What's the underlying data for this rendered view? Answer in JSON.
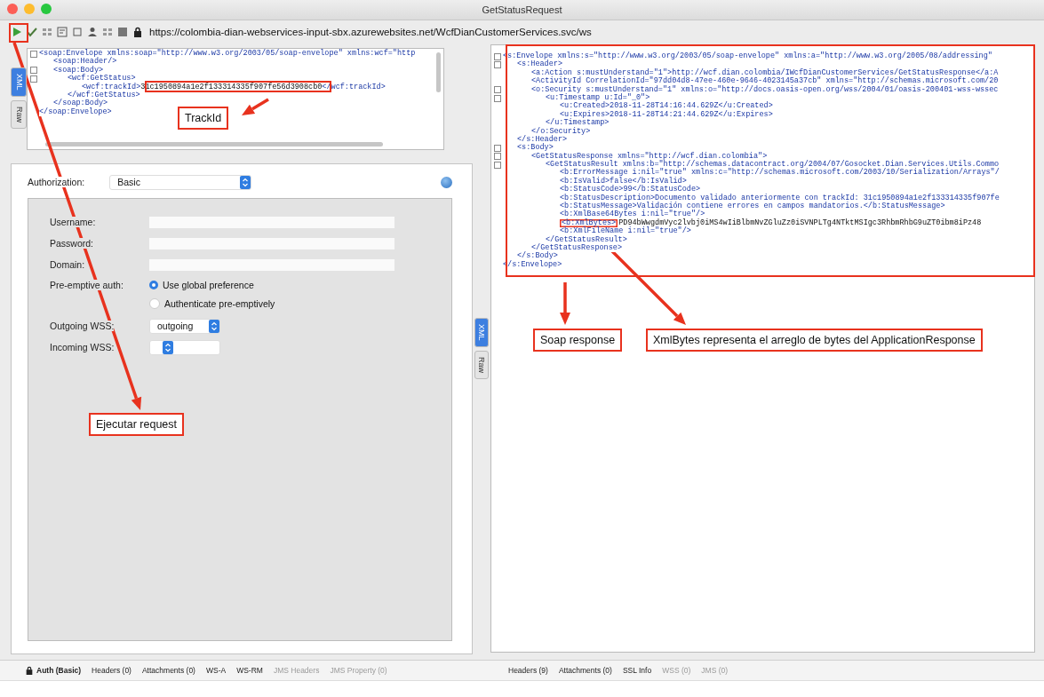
{
  "window": {
    "title": "GetStatusRequest"
  },
  "toolbar": {
    "url": "https://colombia-dian-webservices-input-sbx.azurewebsites.net/WcfDianCustomerServices.svc/ws"
  },
  "request_editor": {
    "tabs": [
      {
        "label": "XML",
        "selected": true
      },
      {
        "label": "Raw",
        "selected": false
      }
    ],
    "xml": [
      {
        "open": "<soap:Envelope xmlns:soap=\"http://www.w3.org/2003/05/soap-envelope\" xmlns:wcf=\"http",
        "close": "</soap:Envelope>",
        "children": [
          {
            "text": "<soap:Header/>"
          },
          {
            "open": "<soap:Body>",
            "close": "</soap:Body>",
            "children": [
              {
                "open": "<wcf:GetStatus>",
                "close": "</wcf:GetStatus>",
                "children": [
                  {
                    "tag": "<wcf:trackId>",
                    "value": "31c1950894a1e2f133314335f907fe56d3908cb0",
                    "end": "</wcf:trackId>"
                  }
                ]
              }
            ]
          }
        ]
      }
    ]
  },
  "auth": {
    "authorization": {
      "label": "Authorization:",
      "value": "Basic"
    },
    "fields": [
      {
        "label": "Username:"
      },
      {
        "label": "Password:"
      },
      {
        "label": "Domain:"
      }
    ],
    "preemptive": {
      "label": "Pre-emptive auth:",
      "options": [
        {
          "label": "Use global preference",
          "selected": true
        },
        {
          "label": "Authenticate pre-emptively",
          "selected": false
        }
      ]
    },
    "wss": [
      {
        "label": "Outgoing WSS:",
        "value": "outgoing"
      },
      {
        "label": "Incoming WSS:"
      }
    ]
  },
  "request_tabs": [
    {
      "label": "Auth (Basic)",
      "selected": true,
      "disabled": false
    },
    {
      "label": "Headers (0)",
      "selected": false,
      "disabled": false
    },
    {
      "label": "Attachments (0)",
      "selected": false,
      "disabled": false
    },
    {
      "label": "WS-A",
      "selected": false,
      "disabled": false
    },
    {
      "label": "WS-RM",
      "selected": false,
      "disabled": false
    },
    {
      "label": "JMS Headers",
      "selected": false,
      "disabled": true
    },
    {
      "label": "JMS Property (0)",
      "selected": false,
      "disabled": true
    }
  ],
  "response_editor": {
    "tabs": [
      {
        "label": "XML",
        "selected": true
      },
      {
        "label": "Raw",
        "selected": false
      }
    ],
    "xml": [
      {
        "open": "<s:Envelope xmlns:s=\"http://www.w3.org/2003/05/soap-envelope\" xmlns:a=\"http://www.w3.org/2005/08/addressing\"",
        "close": "</s:Envelope>",
        "children": [
          {
            "open": "<s:Header>",
            "close": "</s:Header>",
            "children": [
              {
                "text": "<a:Action s:mustUnderstand=\"1\">http://wcf.dian.colombia/IWcfDianCustomerServices/GetStatusResponse</a:A"
              },
              {
                "text": "<ActivityId CorrelationId=\"97dd04d8-47ee-460e-9646-4023145a37cb\" xmlns=\"http://schemas.microsoft.com/20"
              },
              {
                "open": "<o:Security s:mustUnderstand=\"1\" xmlns:o=\"http://docs.oasis-open.org/wss/2004/01/oasis-200401-wss-wssec",
                "close": "</o:Security>",
                "children": [
                  {
                    "open": "<u:Timestamp u:Id=\"_0\">",
                    "close": "</u:Timestamp>",
                    "children": [
                      {
                        "text": "<u:Created>2018-11-28T14:16:44.629Z</u:Created>"
                      },
                      {
                        "text": "<u:Expires>2018-11-28T14:21:44.629Z</u:Expires>"
                      }
                    ]
                  }
                ]
              }
            ]
          },
          {
            "open": "<s:Body>",
            "close": "</s:Body>",
            "children": [
              {
                "open": "<GetStatusResponse xmlns=\"http://wcf.dian.colombia\">",
                "close": "</GetStatusResponse>",
                "children": [
                  {
                    "open": "<GetStatusResult xmlns:b=\"http://schemas.datacontract.org/2004/07/Gosocket.Dian.Services.Utils.Commo",
                    "close": "</GetStatusResult>",
                    "children": [
                      {
                        "text": "<b:ErrorMessage i:nil=\"true\" xmlns:c=\"http://schemas.microsoft.com/2003/10/Serialization/Arrays\"/"
                      },
                      {
                        "text": "<b:IsValid>false</b:IsValid>"
                      },
                      {
                        "text": "<b:StatusCode>99</b:StatusCode>"
                      },
                      {
                        "text": "<b:StatusDescription>Documento validado anteriormente con trackId: 31c1950894a1e2f133314335f907fe"
                      },
                      {
                        "text": "<b:StatusMessage>Validación contiene errores en campos mandatorios.</b:StatusMessage>"
                      },
                      {
                        "text": "<b:XmlBase64Bytes i:nil=\"true\"/>"
                      },
                      {
                        "tag": "<b:XmlBytes>",
                        "value": "PD94bWwgdmVyc2lvbj0iMS4wIiBlbmNvZGluZz0iSVNPLTg4NTktMSIgc3RhbmRhbG9uZT0ibm8iPz48"
                      },
                      {
                        "text": "<b:XmlFileName i:nil=\"true\"/>"
                      }
                    ]
                  }
                ]
              }
            ]
          }
        ]
      }
    ]
  },
  "response_tabs": [
    {
      "label": "Headers (9)",
      "selected": false,
      "disabled": false
    },
    {
      "label": "Attachments (0)",
      "selected": false,
      "disabled": false
    },
    {
      "label": "SSL Info",
      "selected": false,
      "disabled": false
    },
    {
      "label": "WSS (0)",
      "selected": false,
      "disabled": true
    },
    {
      "label": "JMS (0)",
      "selected": false,
      "disabled": true
    }
  ],
  "annotations": [
    {
      "text": "TrackId"
    },
    {
      "text": "Soap response"
    },
    {
      "text": "XmlBytes representa el arreglo de bytes del ApplicationResponse"
    },
    {
      "text": "Ejecutar request"
    }
  ]
}
